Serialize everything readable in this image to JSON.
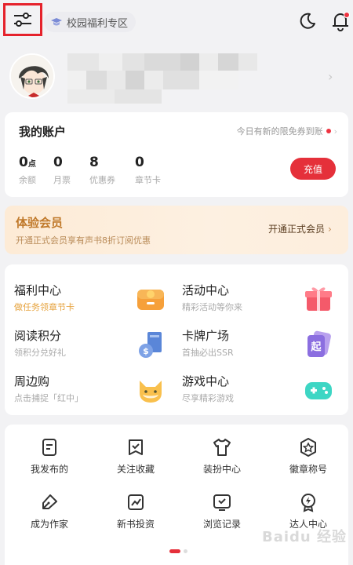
{
  "topbar": {
    "campus_label": "校园福利专区",
    "icons": [
      "settings-sliders-icon",
      "graduation-cap-icon",
      "moon-icon",
      "bell-icon"
    ]
  },
  "account": {
    "title": "我的账户",
    "promo": "今日有新的限免券到账",
    "stats": [
      {
        "value": "0",
        "unit": "点",
        "label": "余额"
      },
      {
        "value": "0",
        "unit": "",
        "label": "月票"
      },
      {
        "value": "8",
        "unit": "",
        "label": "优惠券"
      },
      {
        "value": "0",
        "unit": "",
        "label": "章节卡"
      }
    ],
    "recharge_label": "充值"
  },
  "vip": {
    "title": "体验会员",
    "subtitle": "开通正式会员享有声书8折订阅优惠",
    "button": "开通正式会员"
  },
  "services": [
    {
      "name": "福利中心",
      "desc": "做任务领章节卡",
      "icon": "coin-box-icon"
    },
    {
      "name": "活动中心",
      "desc": "精彩活动等你来",
      "icon": "gift-box-icon"
    },
    {
      "name": "阅读积分",
      "desc": "领积分兑好礼",
      "icon": "points-book-icon"
    },
    {
      "name": "卡牌广场",
      "desc": "首抽必出SSR",
      "icon": "card-icon"
    },
    {
      "name": "周边购",
      "desc": "点击捕捉「红中」",
      "icon": "fox-icon"
    },
    {
      "name": "游戏中心",
      "desc": "尽享精彩游戏",
      "icon": "gamepad-icon"
    }
  ],
  "grid": [
    {
      "label": "我发布的",
      "icon": "document-icon"
    },
    {
      "label": "关注收藏",
      "icon": "bookmark-check-icon"
    },
    {
      "label": "装扮中心",
      "icon": "tshirt-icon"
    },
    {
      "label": "徽章称号",
      "icon": "badge-star-icon"
    },
    {
      "label": "成为作家",
      "icon": "pen-nib-icon"
    },
    {
      "label": "新书投资",
      "icon": "trend-chart-icon"
    },
    {
      "label": "浏览记录",
      "icon": "history-heart-icon"
    },
    {
      "label": "达人中心",
      "icon": "lightning-badge-icon"
    }
  ],
  "watermark": "Baidu 经验",
  "colors": {
    "accent": "#e5303a",
    "vip_gold": "#c0792a",
    "background": "#f2f2f4"
  }
}
